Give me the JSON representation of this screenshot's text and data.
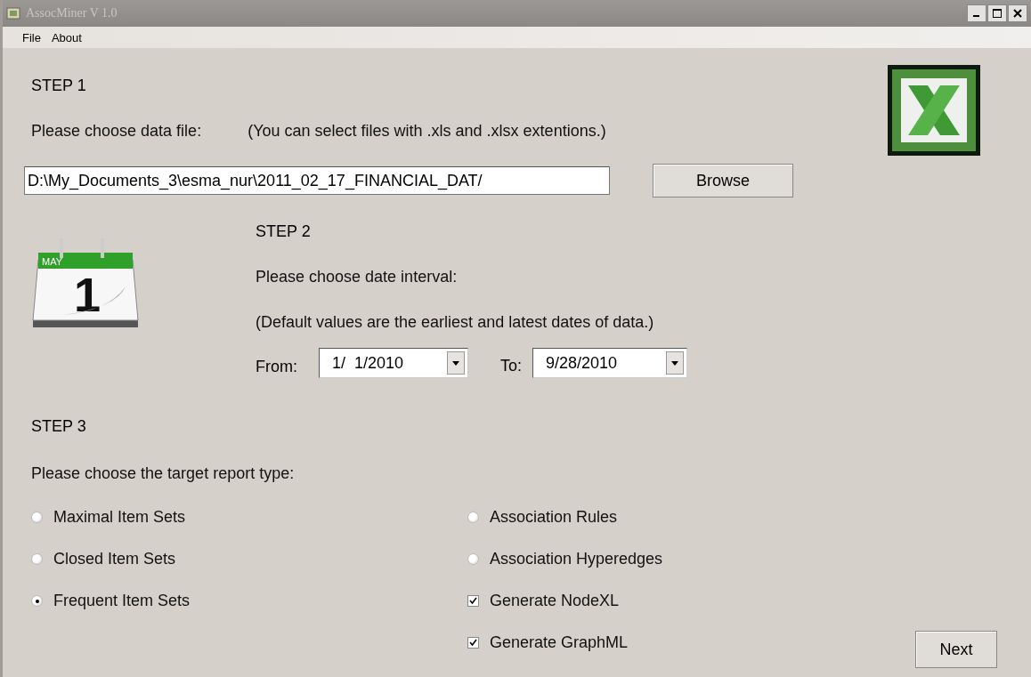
{
  "window": {
    "title": "AssocMiner V 1.0"
  },
  "menu": [
    "File",
    "About"
  ],
  "step1": {
    "heading": "STEP 1",
    "prompt": "Please choose data file:",
    "hint": "(You can select files with .xls and .xlsx extentions.)",
    "path": "D:\\My_Documents_3\\esma_nur\\2011_02_17_FINANCIAL_DAT/",
    "browse": "Browse"
  },
  "calendar": {
    "month": "MAY",
    "day": "1"
  },
  "step2": {
    "heading": "STEP 2",
    "prompt": "Please choose date interval:",
    "note": "(Default values are the earliest and latest dates of data.)",
    "from_label": "From:",
    "from": "1/  1/2010",
    "to_label": "To:",
    "to": "9/28/2010"
  },
  "step3": {
    "heading": "STEP 3",
    "prompt": "Please choose the target report type:",
    "left": [
      {
        "kind": "radio",
        "label": "Maximal Item Sets",
        "selected": false
      },
      {
        "kind": "radio",
        "label": "Closed Item Sets",
        "selected": false
      },
      {
        "kind": "radio",
        "label": "Frequent Item Sets",
        "selected": true
      }
    ],
    "right": [
      {
        "kind": "radio",
        "label": "Association Rules",
        "selected": false
      },
      {
        "kind": "radio",
        "label": "Association Hyperedges",
        "selected": false
      },
      {
        "kind": "checkbox",
        "label": "Generate NodeXL",
        "checked": true
      },
      {
        "kind": "checkbox",
        "label": "Generate GraphML",
        "checked": true
      }
    ]
  },
  "next": "Next"
}
